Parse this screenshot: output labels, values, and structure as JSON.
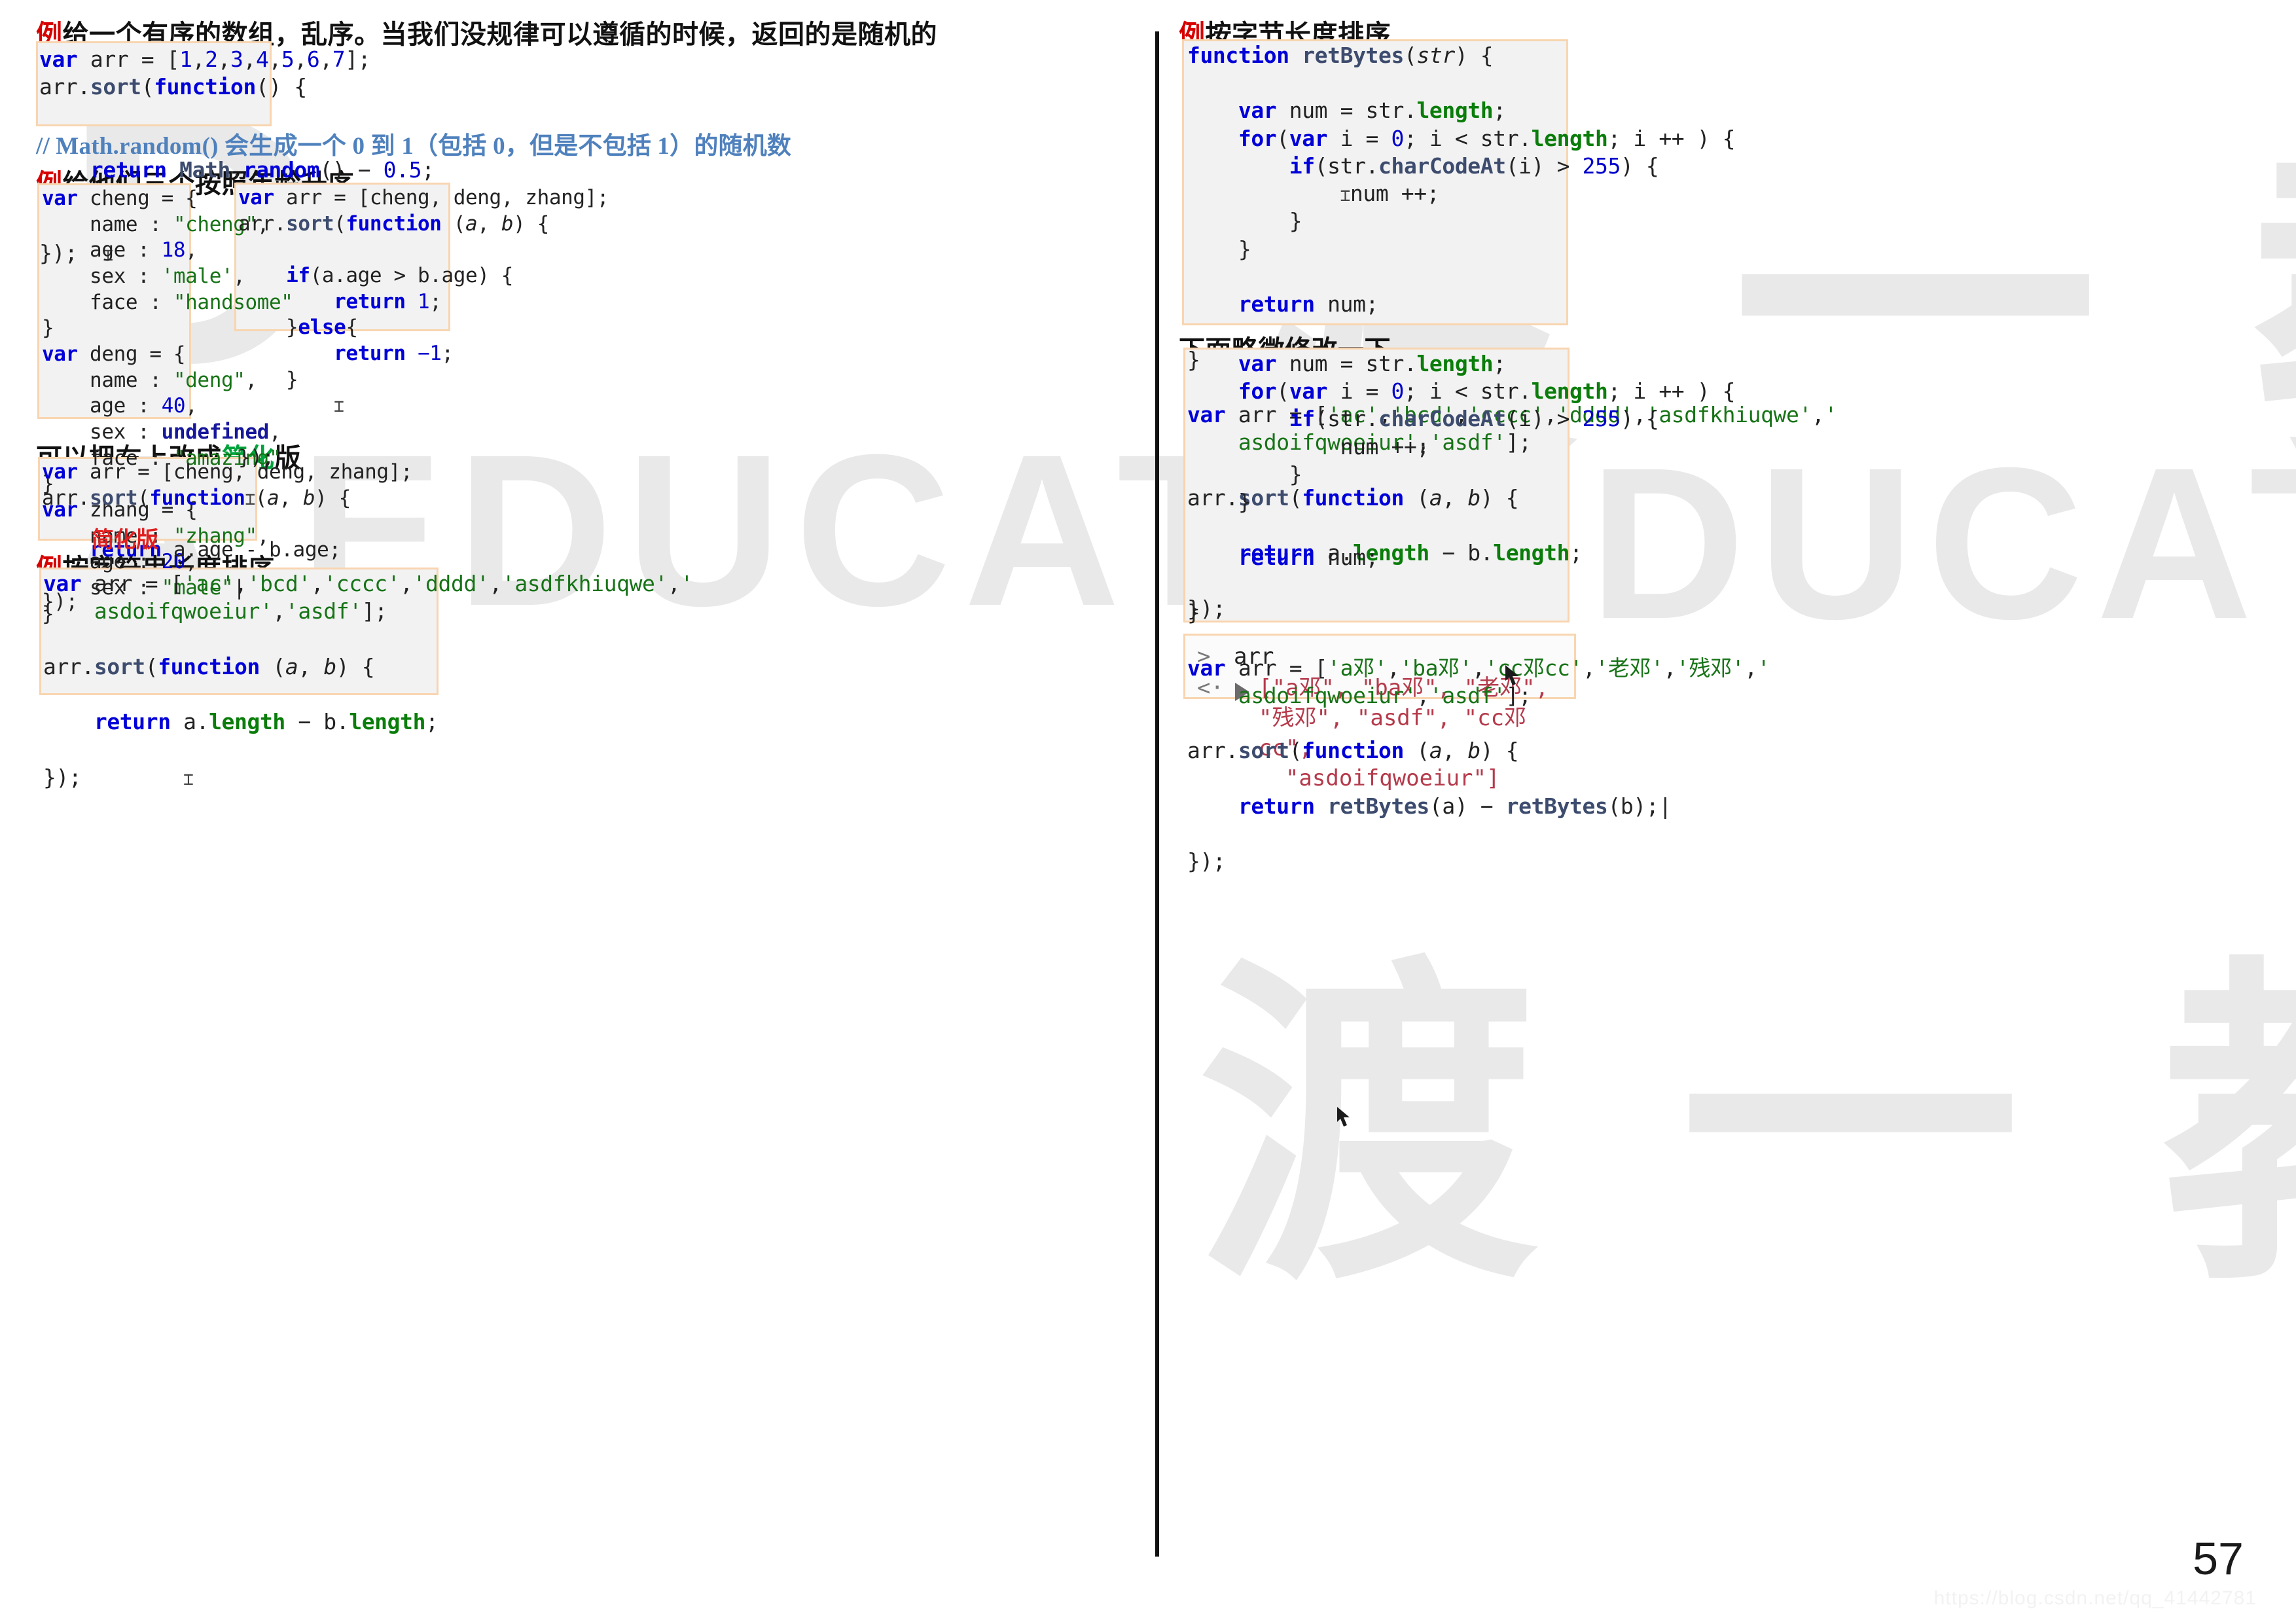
{
  "page": {
    "number": "57",
    "watermark_text": "渡一教育",
    "watermark_url": "https://blog.csdn.net/qq_41442781",
    "wm_d": "D",
    "wm_edu": "A EDUCATIO",
    "wm_cn": "渡 一 教"
  },
  "left": {
    "section1": {
      "heading_ex": "例",
      "heading_text": "给一个有序的数组，乱序。当我们没规律可以遵循的时候，返回的是随机的",
      "code": "var arr = [1,2,3,4,5,6,7];\narr.sort(function() {\n\n\n    return Math.random() - 0.5;\n\n\n});",
      "note": "// Math.random()  会生成一个 0 到 1（包括 0，但是不包括 1）的随机数"
    },
    "section2": {
      "heading_ex": "例",
      "heading_text": "给他们三个按照年龄升序",
      "code_left": "var cheng = {\n    name : \"cheng\",\n    age : 18,\n    sex : 'male',\n    face : \"handsome\"\n}\nvar deng = {\n    name : \"deng\",\n    age : 40,\n    sex : undefined,\n    face : \"amazing\"\n}\nvar zhang = {\n    name : \"zhang\",\n    age : 20,\n    sex : \"male\"\n}",
      "code_right": "var arr = [cheng, deng, zhang];\narr.sort(function (a, b) {\n\n    if(a.age > b.age) {\n        return 1;\n    }else{\n        return -1;\n    }\n\n\n});"
    },
    "section3": {
      "heading_pre": "可以把右上改成",
      "heading_green": "简化",
      "heading_post": "版",
      "code": "var arr = [cheng, deng, zhang];\narr.sort(function (a, b) {\n\n    return a.age - b.age;\n\n});",
      "inline_label": "简化版"
    },
    "section4": {
      "heading_ex": "例",
      "heading_text": "按字符串长度排序",
      "code": "var arr = ['ac','bcd','cccc','dddd','asdfkhiuqwe','\n    asdoifqwoeiur','asdf'];\n\narr.sort(function (a, b) {\n\n    return a.length - b.length;\n\n});"
    }
  },
  "right": {
    "section1": {
      "heading_ex": "例",
      "heading_text": "按字节长度排序",
      "code": "function retBytes(str) {\n\n    var num = str.length;\n    for(var i = 0; i < str.length; i ++ ) {\n        if(str.charCodeAt(i) > 255) {\n            num ++;\n        }\n    }\n\n    return num;\n\n}\n\nvar arr = ['ac','bcd','cccc','dddd','asdfkhiuqwe','\n    asdoifqwoeiur','asdf'];\n\narr.sort(function (a, b) {\n\n    return a.length - b.length;\n\n});"
    },
    "section2": {
      "heading_text": "下面略微修改一下",
      "code": "    var num = str.length;\n    for(var i = 0; i < str.length; i ++ ) {\n        if(str.charCodeAt(i) > 255) {\n            num ++;\n        }\n    }\n\n    return num;\n\n}\n\nvar arr = ['a邓','ba邓','cc邓cc','老邓','残邓','\n    asdoifqwoeiur','asdf'];\n\narr.sort(function (a, b) {\n\n    return retBytes(a) - retBytes(b);\n\n});"
    },
    "console": {
      "prompt_symbol": ">",
      "input_symbol": "<·",
      "command": "arr",
      "result": "[\"a邓\", \"ba邓\", \"老邓\", \"残邓\", \"asdf\", \"cc邓cc\",\n  \"asdoifqwoeiur\"]"
    }
  },
  "colors": {
    "accent_red": "#d60000",
    "accent_green": "#00a33c",
    "note_blue": "#4f81bd",
    "code_border": "#f8d5b0",
    "code_bg": "#f2f2f2",
    "console_value": "#b53a4b"
  }
}
